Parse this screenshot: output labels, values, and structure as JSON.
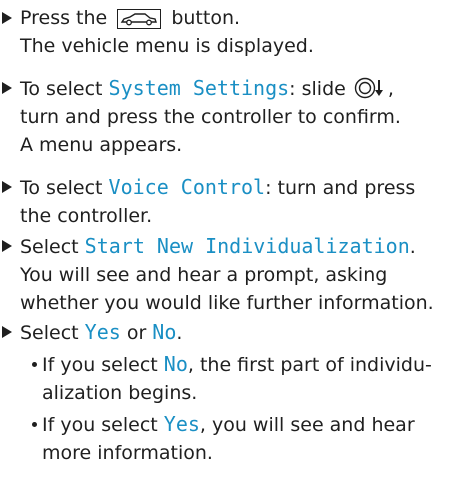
{
  "steps": [
    {
      "prefix": "Press the",
      "icon": "vehicle-button-icon",
      "suffix": "button.",
      "continuation": "The vehicle menu is displayed."
    },
    {
      "prefix": "To select ",
      "term": "System Settings",
      "mid": ": slide",
      "icon": "controller-slide-down-icon",
      "suffix": ",",
      "line2": "turn and press the controller to confirm.",
      "continuation": "A menu appears."
    },
    {
      "prefix": "To select ",
      "term": "Voice Control",
      "suffix": ": turn and press",
      "line2": "the controller."
    },
    {
      "prefix": "Select ",
      "term": "Start New Individualization",
      "suffix": ".",
      "line2": "You will see and hear a prompt, asking",
      "line3": "whether you would like further information."
    },
    {
      "prefix": "Select ",
      "term1": "Yes",
      "mid": " or ",
      "term2": "No",
      "suffix": "."
    }
  ],
  "bullets": [
    {
      "prefix": "If you select ",
      "term": "No",
      "suffix": ", the first part of individu-",
      "line2": "alization begins."
    },
    {
      "prefix": "If you select ",
      "term": "Yes",
      "suffix": ", you will see and hear",
      "line2": "more information."
    }
  ],
  "colors": {
    "term": "#1a8fc4",
    "text": "#1f1f1f"
  }
}
